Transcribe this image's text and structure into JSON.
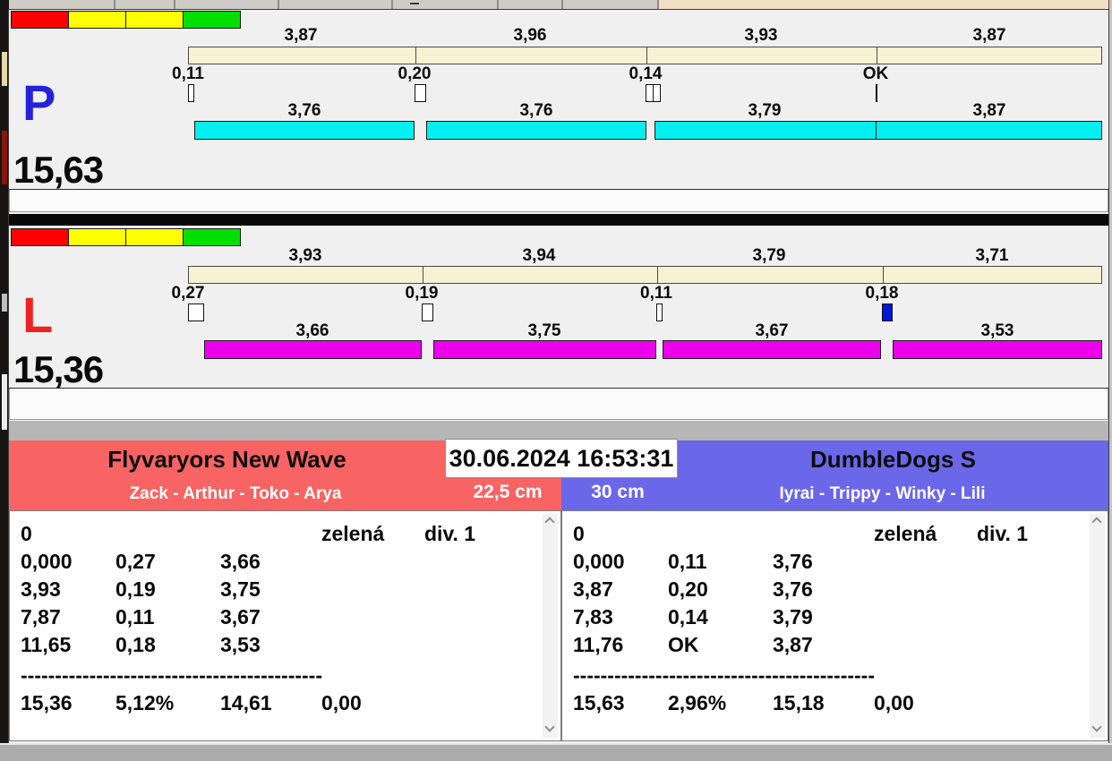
{
  "window": {
    "timestamp": "30.06.2024 16:53:31",
    "traffic_light_colors": [
      "#FF0000",
      "#FFFF00",
      "#FFFF00",
      "#00DF00"
    ],
    "marker_blue_color": "#0018D8"
  },
  "lanes": [
    {
      "letter": "P",
      "letter_color": "#2222DD",
      "run_bar_color": "#00EFEF",
      "total_time": "15,63",
      "segments": [
        {
          "split_time": "3,87",
          "split_value": 3.87,
          "change_time": "0,11",
          "change_value": 0.11,
          "marker": "box",
          "run_time": "3,76",
          "run_value": 3.76
        },
        {
          "split_time": "3,96",
          "split_value": 3.96,
          "change_time": "0,20",
          "change_value": 0.2,
          "marker": "box",
          "run_time": "3,76",
          "run_value": 3.76
        },
        {
          "split_time": "3,93",
          "split_value": 3.93,
          "change_time": "0,14",
          "change_value": 0.14,
          "marker": "double-box",
          "run_time": "3,79",
          "run_value": 3.79
        },
        {
          "split_time": "3,87",
          "split_value": 3.87,
          "change_time": "OK",
          "change_value": 0,
          "marker": "tick",
          "run_time": "3,87",
          "run_value": 3.87
        }
      ]
    },
    {
      "letter": "L",
      "letter_color": "#EE2222",
      "run_bar_color": "#EC00EC",
      "total_time": "15,36",
      "segments": [
        {
          "split_time": "3,93",
          "split_value": 3.93,
          "change_time": "0,27",
          "change_value": 0.27,
          "marker": "box",
          "run_time": "3,66",
          "run_value": 3.66
        },
        {
          "split_time": "3,94",
          "split_value": 3.94,
          "change_time": "0,19",
          "change_value": 0.19,
          "marker": "box",
          "run_time": "3,75",
          "run_value": 3.75
        },
        {
          "split_time": "3,79",
          "split_value": 3.79,
          "change_time": "0,11",
          "change_value": 0.11,
          "marker": "box",
          "run_time": "3,67",
          "run_value": 3.67
        },
        {
          "split_time": "3,71",
          "split_value": 3.71,
          "change_time": "0,18",
          "change_value": 0.18,
          "marker": "box-blue",
          "run_time": "3,53",
          "run_value": 3.53
        }
      ]
    }
  ],
  "team_panels": [
    {
      "team_name": "Flyvaryors New Wave",
      "dog_names": "Zack - Arthur - Toko - Arya",
      "jump_height": "22,5 cm",
      "header_color": "#F86363",
      "results": {
        "first_row": {
          "start": "0",
          "light": "zelená",
          "division": "div. 1"
        },
        "splits": [
          [
            "0,000",
            "0,27",
            "3,66"
          ],
          [
            "3,93",
            "0,19",
            "3,75"
          ],
          [
            "7,87",
            "0,11",
            "3,67"
          ],
          [
            "11,65",
            "0,18",
            "3,53"
          ]
        ],
        "totals": [
          "15,36",
          "5,12%",
          "14,61",
          "0,00"
        ]
      }
    },
    {
      "team_name": "DumbleDogs S",
      "dog_names": "Iyrai - Trippy - Winky - Lili",
      "jump_height": "30 cm",
      "header_color": "#6B67E9",
      "results": {
        "first_row": {
          "start": "0",
          "light": "zelená",
          "division": "div. 1"
        },
        "splits": [
          [
            "0,000",
            "0,11",
            "3,76"
          ],
          [
            "3,87",
            "0,20",
            "3,76"
          ],
          [
            "7,83",
            "0,14",
            "3,79"
          ],
          [
            "11,76",
            "OK",
            "3,87"
          ]
        ],
        "totals": [
          "15,63",
          "2,96%",
          "15,18",
          "0,00"
        ]
      }
    }
  ],
  "separator": "--------------------------------------------"
}
